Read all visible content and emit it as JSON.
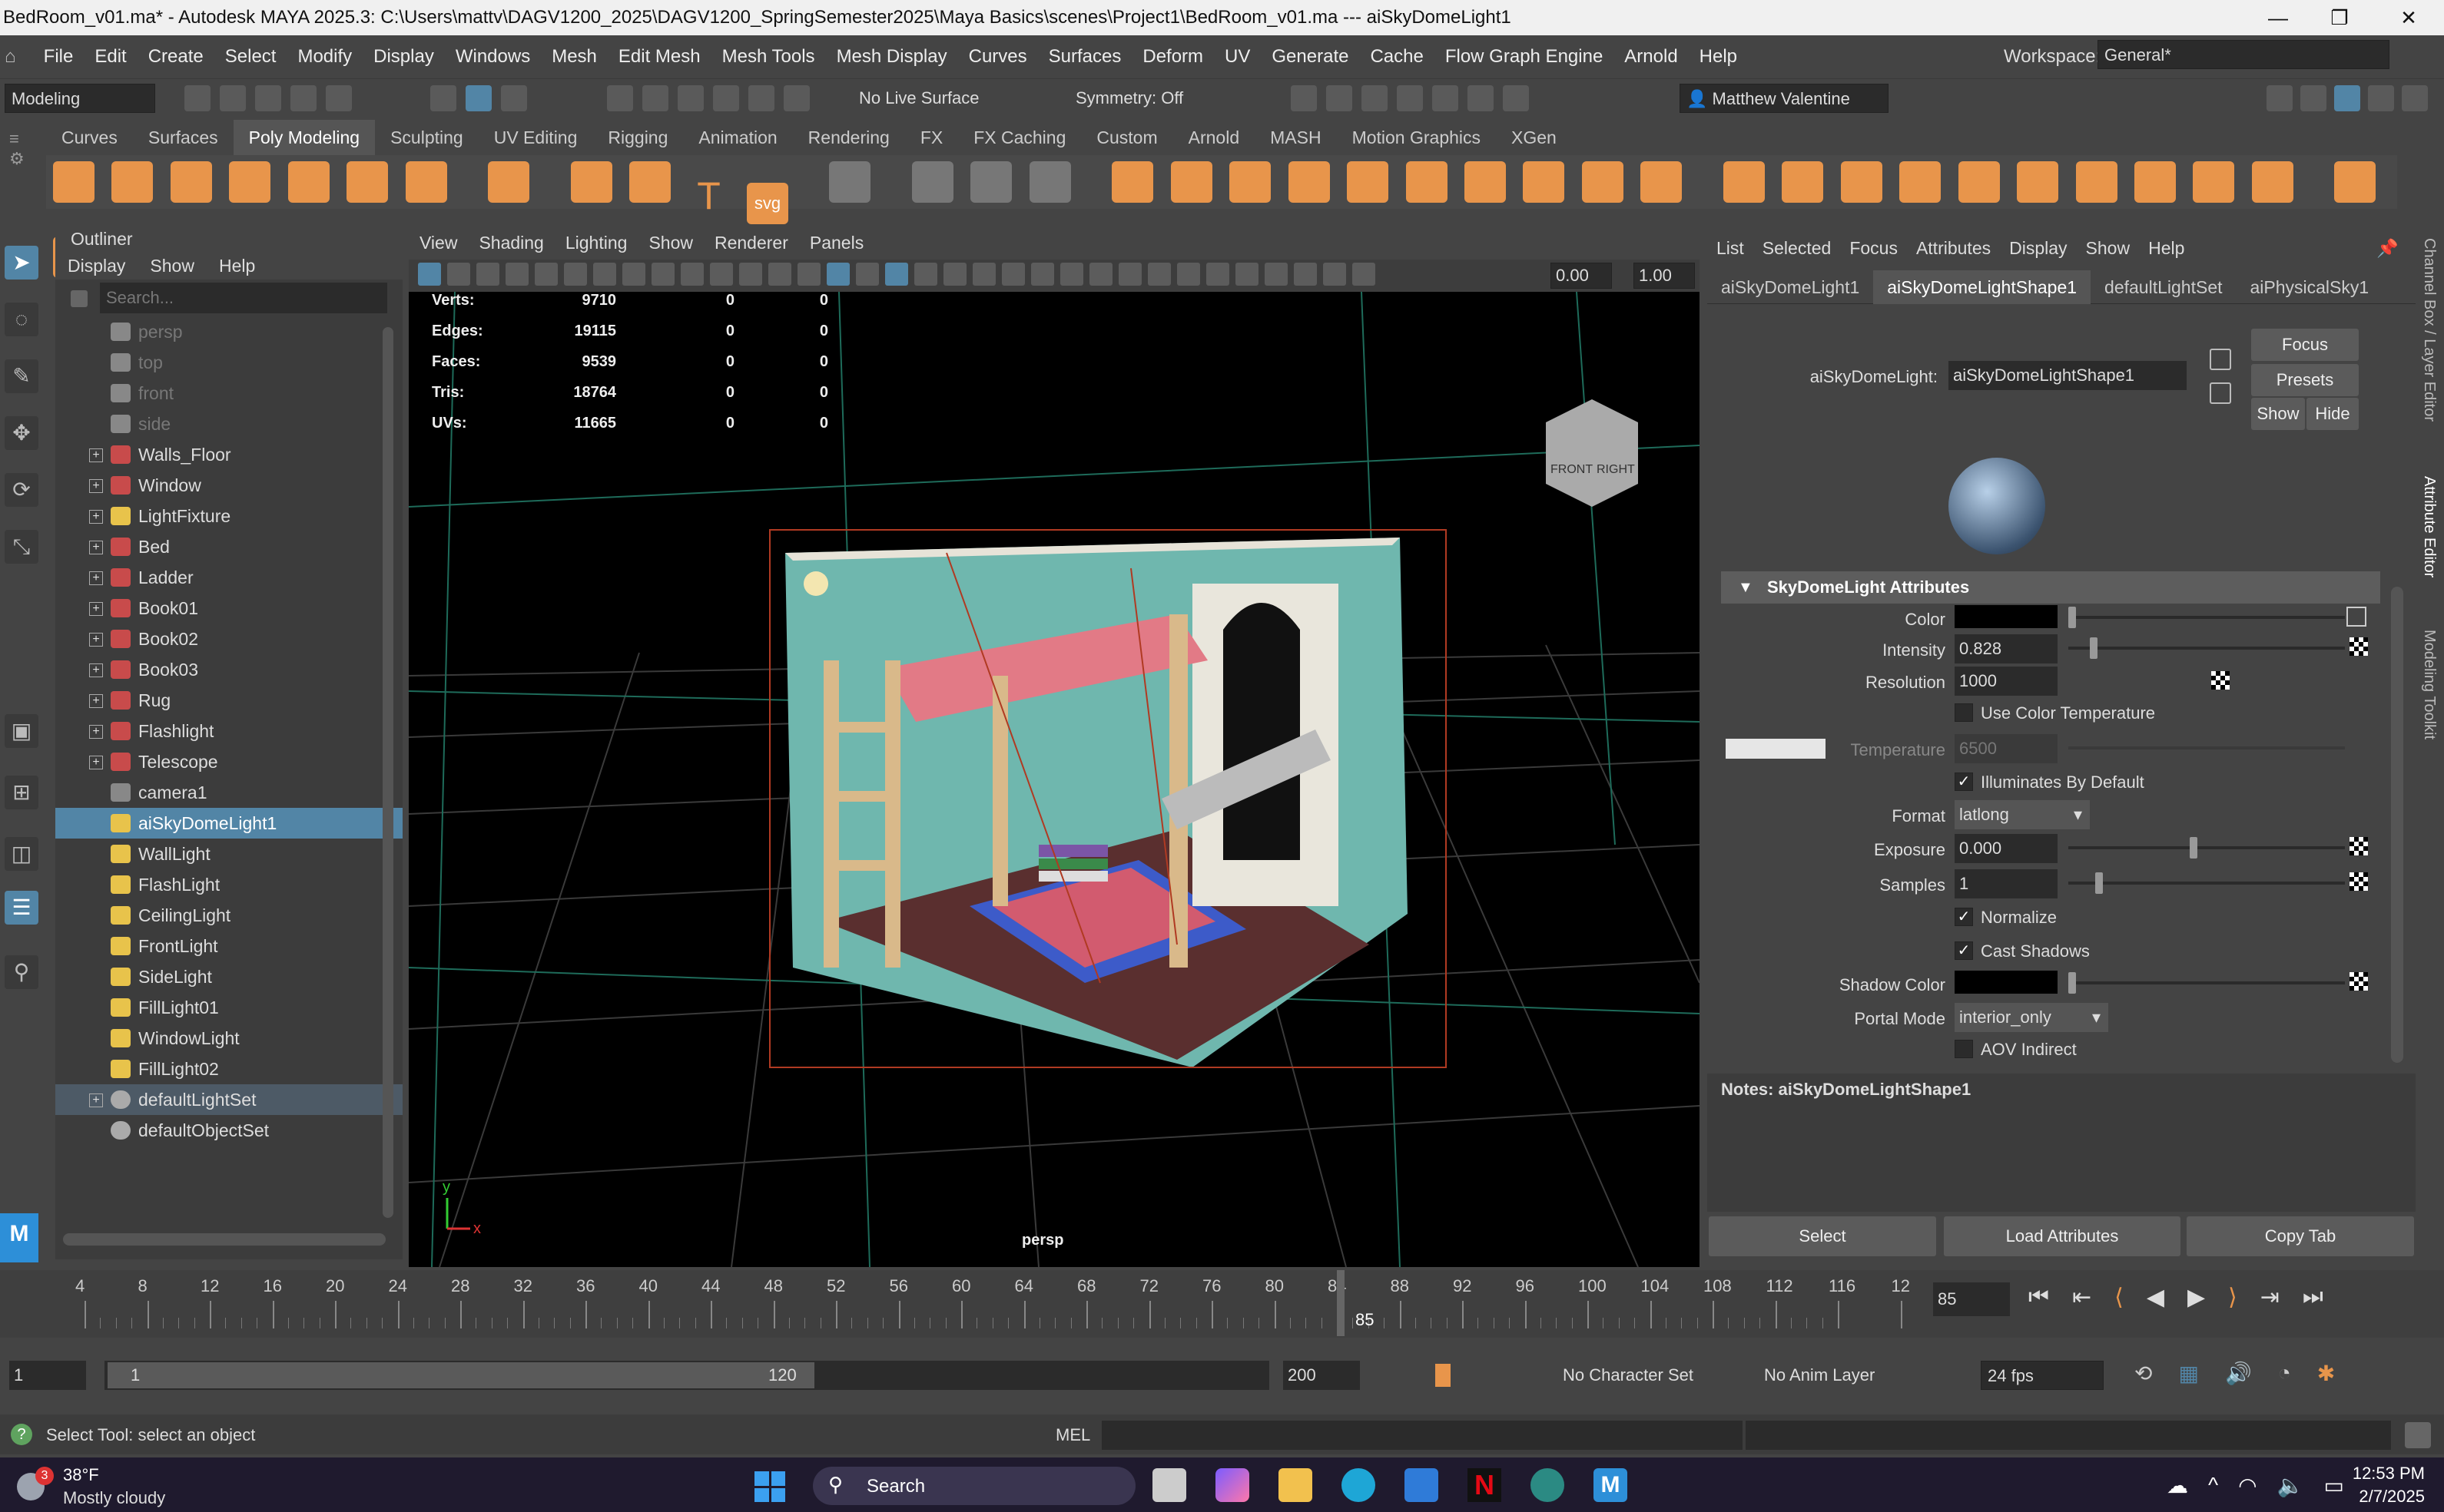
{
  "title_bar": {
    "text": "BedRoom_v01.ma* - Autodesk MAYA 2025.3: C:\\Users\\mattv\\DAGV1200_2025\\DAGV1200_SpringSemester2025\\Maya Basics\\scenes\\Project1\\BedRoom_v01.ma   ---   aiSkyDomeLight1",
    "minimize": "—",
    "maximize": "❐",
    "close": "✕"
  },
  "menubar": {
    "items": [
      "File",
      "Edit",
      "Create",
      "Select",
      "Modify",
      "Display",
      "Windows",
      "Mesh",
      "Edit Mesh",
      "Mesh Tools",
      "Mesh Display",
      "Curves",
      "Surfaces",
      "Deform",
      "UV",
      "Generate",
      "Cache",
      "Flow Graph Engine",
      "Arnold",
      "Help"
    ],
    "workspace_label": "Workspace:",
    "workspace_value": "General*"
  },
  "statusline": {
    "mode": "Modeling",
    "live_surface": "No Live Surface",
    "symmetry": "Symmetry: Off",
    "user": "Matthew Valentine"
  },
  "shelf": {
    "tabs": [
      "Curves",
      "Surfaces",
      "Poly Modeling",
      "Sculpting",
      "UV Editing",
      "Rigging",
      "Animation",
      "Rendering",
      "FX",
      "FX Caching",
      "Custom",
      "Arnold",
      "MASH",
      "Motion Graphics",
      "XGen"
    ],
    "active_tab": "Poly Modeling",
    "text_icon": "T",
    "svg_icon": "svg"
  },
  "outliner": {
    "title": "Outliner",
    "menu": [
      "Display",
      "Show",
      "Help"
    ],
    "search_placeholder": "Search...",
    "items": [
      {
        "label": "persp",
        "expandable": false,
        "state": "dim"
      },
      {
        "label": "top",
        "expandable": false,
        "state": "dim"
      },
      {
        "label": "front",
        "expandable": false,
        "state": "dim"
      },
      {
        "label": "side",
        "expandable": false,
        "state": "dim"
      },
      {
        "label": "Walls_Floor",
        "expandable": true,
        "state": ""
      },
      {
        "label": "Window",
        "expandable": true,
        "state": ""
      },
      {
        "label": "LightFixture",
        "expandable": true,
        "state": ""
      },
      {
        "label": "Bed",
        "expandable": true,
        "state": ""
      },
      {
        "label": "Ladder",
        "expandable": true,
        "state": ""
      },
      {
        "label": "Book01",
        "expandable": true,
        "state": ""
      },
      {
        "label": "Book02",
        "expandable": true,
        "state": ""
      },
      {
        "label": "Book03",
        "expandable": true,
        "state": ""
      },
      {
        "label": "Rug",
        "expandable": true,
        "state": ""
      },
      {
        "label": "Flashlight",
        "expandable": true,
        "state": ""
      },
      {
        "label": "Telescope",
        "expandable": true,
        "state": ""
      },
      {
        "label": "camera1",
        "expandable": false,
        "state": ""
      },
      {
        "label": "aiSkyDomeLight1",
        "expandable": false,
        "state": "sel"
      },
      {
        "label": "WallLight",
        "expandable": false,
        "state": ""
      },
      {
        "label": "FlashLight",
        "expandable": false,
        "state": ""
      },
      {
        "label": "CeilingLight",
        "expandable": false,
        "state": ""
      },
      {
        "label": "FrontLight",
        "expandable": false,
        "state": ""
      },
      {
        "label": "SideLight",
        "expandable": false,
        "state": ""
      },
      {
        "label": "FillLight01",
        "expandable": false,
        "state": ""
      },
      {
        "label": "WindowLight",
        "expandable": false,
        "state": ""
      },
      {
        "label": "FillLight02",
        "expandable": false,
        "state": ""
      },
      {
        "label": "defaultLightSet",
        "expandable": true,
        "state": "hl"
      },
      {
        "label": "defaultObjectSet",
        "expandable": false,
        "state": ""
      }
    ]
  },
  "viewport": {
    "menu": [
      "View",
      "Shading",
      "Lighting",
      "Show",
      "Renderer",
      "Panels"
    ],
    "field_a": "0.00",
    "field_b": "1.00",
    "camera_label": "persp",
    "viewcube_front": "FRONT",
    "viewcube_right": "RIGHT",
    "axis_x": "x",
    "axis_y": "y",
    "hud": [
      {
        "label": "Verts:",
        "v1": "9710",
        "v2": "0",
        "v3": "0"
      },
      {
        "label": "Edges:",
        "v1": "19115",
        "v2": "0",
        "v3": "0"
      },
      {
        "label": "Faces:",
        "v1": "9539",
        "v2": "0",
        "v3": "0"
      },
      {
        "label": "Tris:",
        "v1": "18764",
        "v2": "0",
        "v3": "0"
      },
      {
        "label": "UVs:",
        "v1": "11665",
        "v2": "0",
        "v3": "0"
      }
    ]
  },
  "attribute_editor": {
    "menu": [
      "List",
      "Selected",
      "Focus",
      "Attributes",
      "Display",
      "Show",
      "Help"
    ],
    "tabs": [
      "aiSkyDomeLight1",
      "aiSkyDomeLightShape1",
      "defaultLightSet",
      "aiPhysicalSky1"
    ],
    "active_tab": "aiSkyDomeLightShape1",
    "node_label": "aiSkyDomeLight:",
    "node_value": "aiSkyDomeLightShape1",
    "focus": "Focus",
    "presets": "Presets",
    "show": "Show",
    "hide": "Hide",
    "section": "SkyDomeLight Attributes",
    "color_label": "Color",
    "intensity_label": "Intensity",
    "intensity": "0.828",
    "resolution_label": "Resolution",
    "resolution": "1000",
    "use_color_temp": "Use Color Temperature",
    "temperature_label": "Temperature",
    "temperature": "6500",
    "illuminates": "Illuminates By Default",
    "format_label": "Format",
    "format": "latlong",
    "exposure_label": "Exposure",
    "exposure": "0.000",
    "samples_label": "Samples",
    "samples": "1",
    "normalize": "Normalize",
    "cast_shadows": "Cast Shadows",
    "shadow_color_label": "Shadow Color",
    "portal_mode_label": "Portal Mode",
    "portal_mode": "interior_only",
    "aov_indirect": "AOV Indirect",
    "notes": "Notes:  aiSkyDomeLightShape1",
    "btn_select": "Select",
    "btn_load": "Load Attributes",
    "btn_copy": "Copy Tab",
    "intensity_level": 0.08,
    "exposure_level": 0.45,
    "samples_level": 0.1
  },
  "side_tabs": [
    "Channel Box / Layer Editor",
    "Attribute Editor",
    "Modeling Toolkit"
  ],
  "timeline": {
    "ticks": [
      "4",
      "8",
      "12",
      "16",
      "20",
      "24",
      "28",
      "32",
      "36",
      "40",
      "44",
      "48",
      "52",
      "56",
      "60",
      "64",
      "68",
      "72",
      "76",
      "80",
      "84",
      "88",
      "92",
      "96",
      "100",
      "104",
      "108",
      "112",
      "116",
      "12"
    ],
    "current_frame": "85",
    "current_field": "85"
  },
  "range": {
    "start": "1",
    "range_start": "1",
    "range_end": "120",
    "end": "200",
    "character_set": "No Character Set",
    "anim_layer": "No Anim Layer",
    "fps": "24 fps"
  },
  "command_line": {
    "help": "Select Tool: select an object",
    "lang": "MEL"
  },
  "taskbar": {
    "weather_temp": "38°F",
    "weather_desc": "Mostly cloudy",
    "weather_badge": "3",
    "search": "Search",
    "time": "12:53 PM",
    "date": "2/7/2025"
  }
}
